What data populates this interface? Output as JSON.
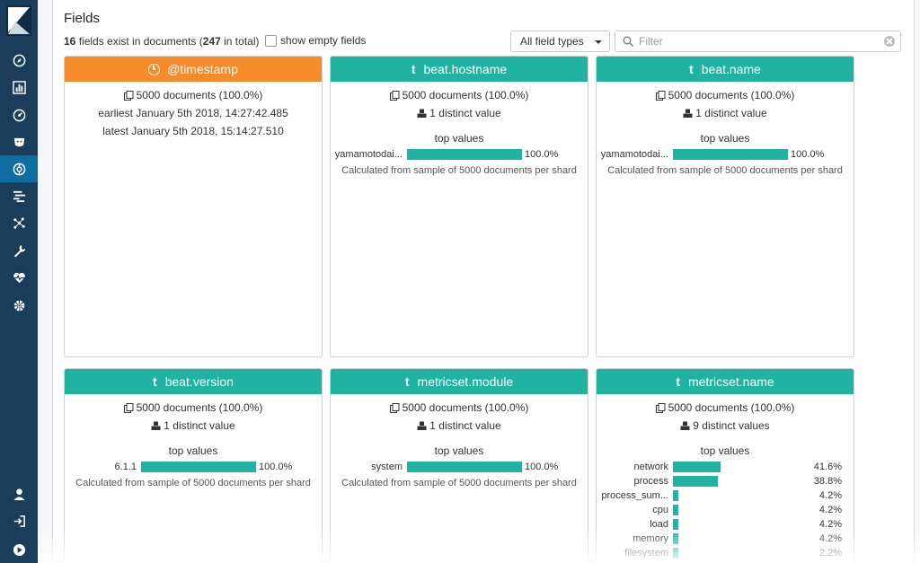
{
  "nav": {
    "items": [
      {
        "name": "discover-icon",
        "active": false
      },
      {
        "name": "visualize-icon",
        "active": false
      },
      {
        "name": "dashboard-icon",
        "active": false
      },
      {
        "name": "timelion-icon",
        "active": false
      },
      {
        "name": "machine-learning-icon",
        "active": true
      },
      {
        "name": "apm-icon",
        "active": false
      },
      {
        "name": "graph-icon",
        "active": false
      },
      {
        "name": "dev-tools-icon",
        "active": false
      },
      {
        "name": "monitoring-icon",
        "active": false
      },
      {
        "name": "management-icon",
        "active": false
      }
    ],
    "bottom": [
      "user-icon",
      "logout-icon",
      "collapse-icon"
    ]
  },
  "header": {
    "title": "Fields",
    "summary_count": "16",
    "summary_mid": " fields exist in documents (",
    "summary_total": "247",
    "summary_end": " in total)",
    "show_empty_label": "show empty fields",
    "type_select": "All field types",
    "filter_placeholder": "Filter"
  },
  "colors": {
    "keyword": "#20b3a1",
    "date": "#f68b2b",
    "nav": "#1a3d5c",
    "nav_active": "#0e6ea1"
  },
  "cards": [
    {
      "name": "@timestamp",
      "type": "date",
      "docs": "5000 documents (100.0%)",
      "earliest": "earliest January 5th 2018, 14:27:42.485",
      "latest": "latest January 5th 2018, 15:14:27.510"
    },
    {
      "name": "beat.hostname",
      "type_icon": "t",
      "docs": "5000 documents (100.0%)",
      "distinct": "1 distinct value",
      "top_label": "top values",
      "top_values": [
        {
          "key": "yamamotodai...",
          "pct": "100.0%",
          "fraction": 1.0
        }
      ],
      "note": "Calculated from sample of 5000 documents per shard"
    },
    {
      "name": "beat.name",
      "type_icon": "t",
      "docs": "5000 documents (100.0%)",
      "distinct": "1 distinct value",
      "top_label": "top values",
      "top_values": [
        {
          "key": "yamamotodai...",
          "pct": "100.0%",
          "fraction": 1.0
        }
      ],
      "note": "Calculated from sample of 5000 documents per shard"
    },
    {
      "name": "beat.version",
      "type_icon": "t",
      "docs": "5000 documents (100.0%)",
      "distinct": "1 distinct value",
      "top_label": "top values",
      "top_values": [
        {
          "key": "6.1.1",
          "pct": "100.0%",
          "fraction": 1.0
        }
      ],
      "note": "Calculated from sample of 5000 documents per shard"
    },
    {
      "name": "metricset.module",
      "type_icon": "t",
      "docs": "5000 documents (100.0%)",
      "distinct": "1 distinct value",
      "top_label": "top values",
      "top_values": [
        {
          "key": "system",
          "pct": "100.0%",
          "fraction": 1.0
        }
      ],
      "note": "Calculated from sample of 5000 documents per shard"
    },
    {
      "name": "metricset.name",
      "type_icon": "t",
      "docs": "5000 documents (100.0%)",
      "distinct": "9 distinct values",
      "top_label": "top values",
      "top_values": [
        {
          "key": "network",
          "pct": "41.6%",
          "fraction": 0.416
        },
        {
          "key": "process",
          "pct": "38.8%",
          "fraction": 0.388
        },
        {
          "key": "process_sum...",
          "pct": "4.2%",
          "fraction": 0.042
        },
        {
          "key": "cpu",
          "pct": "4.2%",
          "fraction": 0.042
        },
        {
          "key": "load",
          "pct": "4.2%",
          "fraction": 0.042
        },
        {
          "key": "memory",
          "pct": "4.2%",
          "fraction": 0.042
        },
        {
          "key": "filesystem",
          "pct": "2.2%",
          "fraction": 0.022
        }
      ]
    }
  ]
}
